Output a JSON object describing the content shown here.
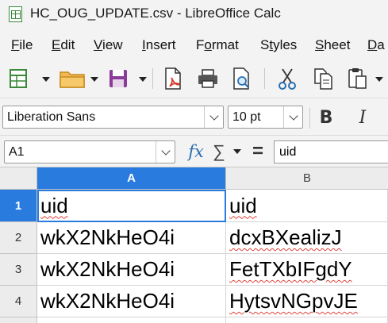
{
  "window": {
    "title": "HC_OUG_UPDATE.csv - LibreOffice Calc"
  },
  "menu": {
    "items": [
      {
        "label": "File",
        "mnemonic_index": 0
      },
      {
        "label": "Edit",
        "mnemonic_index": 0
      },
      {
        "label": "View",
        "mnemonic_index": 0
      },
      {
        "label": "Insert",
        "mnemonic_index": 0
      },
      {
        "label": "Format",
        "mnemonic_index": 1
      },
      {
        "label": "Styles",
        "mnemonic_index": 1
      },
      {
        "label": "Sheet",
        "mnemonic_index": 0
      },
      {
        "label": "Da",
        "mnemonic_index": 0
      }
    ]
  },
  "toolbar": {
    "icons": [
      "new-spreadsheet-icon",
      "open-folder-icon",
      "save-icon",
      "export-pdf-icon",
      "print-icon",
      "print-preview-icon",
      "cut-icon",
      "copy-icon",
      "paste-icon"
    ],
    "colors": {
      "green": "#3a8a3a",
      "orange": "#e8a33c",
      "purple": "#8a3c9a",
      "red": "#d33a2c"
    }
  },
  "formatting": {
    "font_name": "Liberation Sans",
    "font_size": "10 pt",
    "bold_label": "B",
    "italic_label": "I"
  },
  "formula_bar": {
    "name_box": "A1",
    "function_wizard_label": "fx",
    "sum_label": "∑",
    "equals_label": "=",
    "content": "uid"
  },
  "sheet": {
    "columns": [
      "A",
      "B"
    ],
    "selected_column": "A",
    "rows": [
      {
        "header": "1",
        "cells": [
          "uid",
          "uid"
        ]
      },
      {
        "header": "2",
        "cells": [
          "wkX2NkHeO4i",
          "dcxBXealizJ"
        ]
      },
      {
        "header": "3",
        "cells": [
          "wkX2NkHeO4i",
          "FetTXbIFgdY"
        ]
      },
      {
        "header": "4",
        "cells": [
          "wkX2NkHeO4i",
          "HytsvNGpvJE"
        ]
      }
    ],
    "active_cell": "A1",
    "accent_color": "#2a7bde",
    "spellcheck_color": "#e0443c"
  }
}
